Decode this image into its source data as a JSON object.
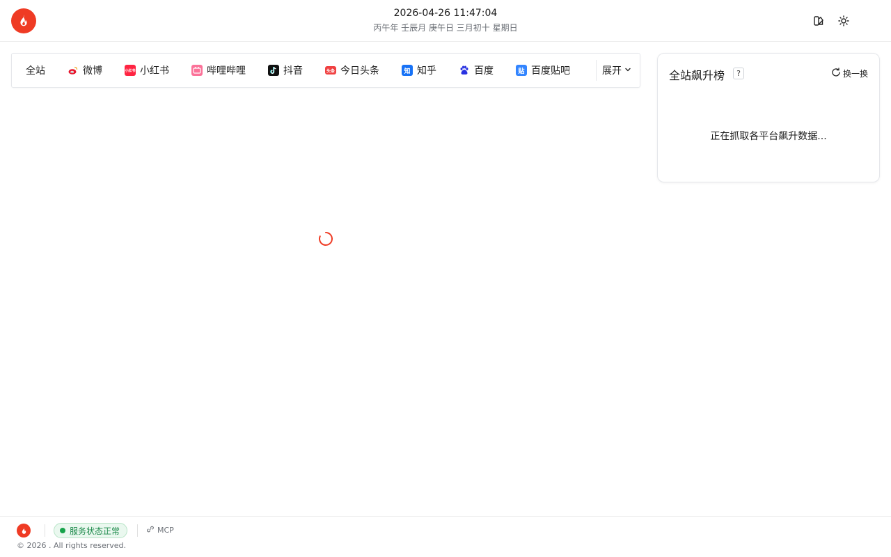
{
  "header": {
    "datetime": "2026-04-26 11:47:04",
    "lunar": "丙午年 壬辰月 庚午日 三月初十 星期日",
    "icons": [
      "flame-logo-icon",
      "theme-palette-icon",
      "sun-icon"
    ]
  },
  "tabs": {
    "items": [
      {
        "label": "全站",
        "icon": null
      },
      {
        "label": "微博",
        "icon": "weibo-icon"
      },
      {
        "label": "小红书",
        "icon": "xiaohongshu-icon"
      },
      {
        "label": "哔哩哔哩",
        "icon": "bilibili-icon"
      },
      {
        "label": "抖音",
        "icon": "douyin-icon"
      },
      {
        "label": "今日头条",
        "icon": "toutiao-icon"
      },
      {
        "label": "知乎",
        "icon": "zhihu-icon"
      },
      {
        "label": "百度",
        "icon": "baidu-icon"
      },
      {
        "label": "百度贴吧",
        "icon": "tieba-icon"
      }
    ],
    "expand_label": "展开",
    "icon_text": {
      "xiaohongshu": "小红书",
      "toutiao": "头条",
      "zhihu": "知",
      "tieba": "贴"
    }
  },
  "rising": {
    "title": "全站飙升榜",
    "help": "?",
    "refresh_label": "换一换",
    "loading_text": "正在抓取各平台飙升数据..."
  },
  "footer": {
    "status": "服务状态正常",
    "mcp": "MCP",
    "copyright": "© 2026 . All rights reserved."
  },
  "colors": {
    "brand": "#ef3b24",
    "status_green": "#16a34a",
    "weibo": "#e6162d",
    "xiaohongshu": "#ff2442",
    "bilibili": "#fb7299",
    "douyin": "#111111",
    "toutiao": "#f04142",
    "zhihu": "#1772f6",
    "baidu": "#2932e1",
    "tieba": "#3385ff"
  }
}
